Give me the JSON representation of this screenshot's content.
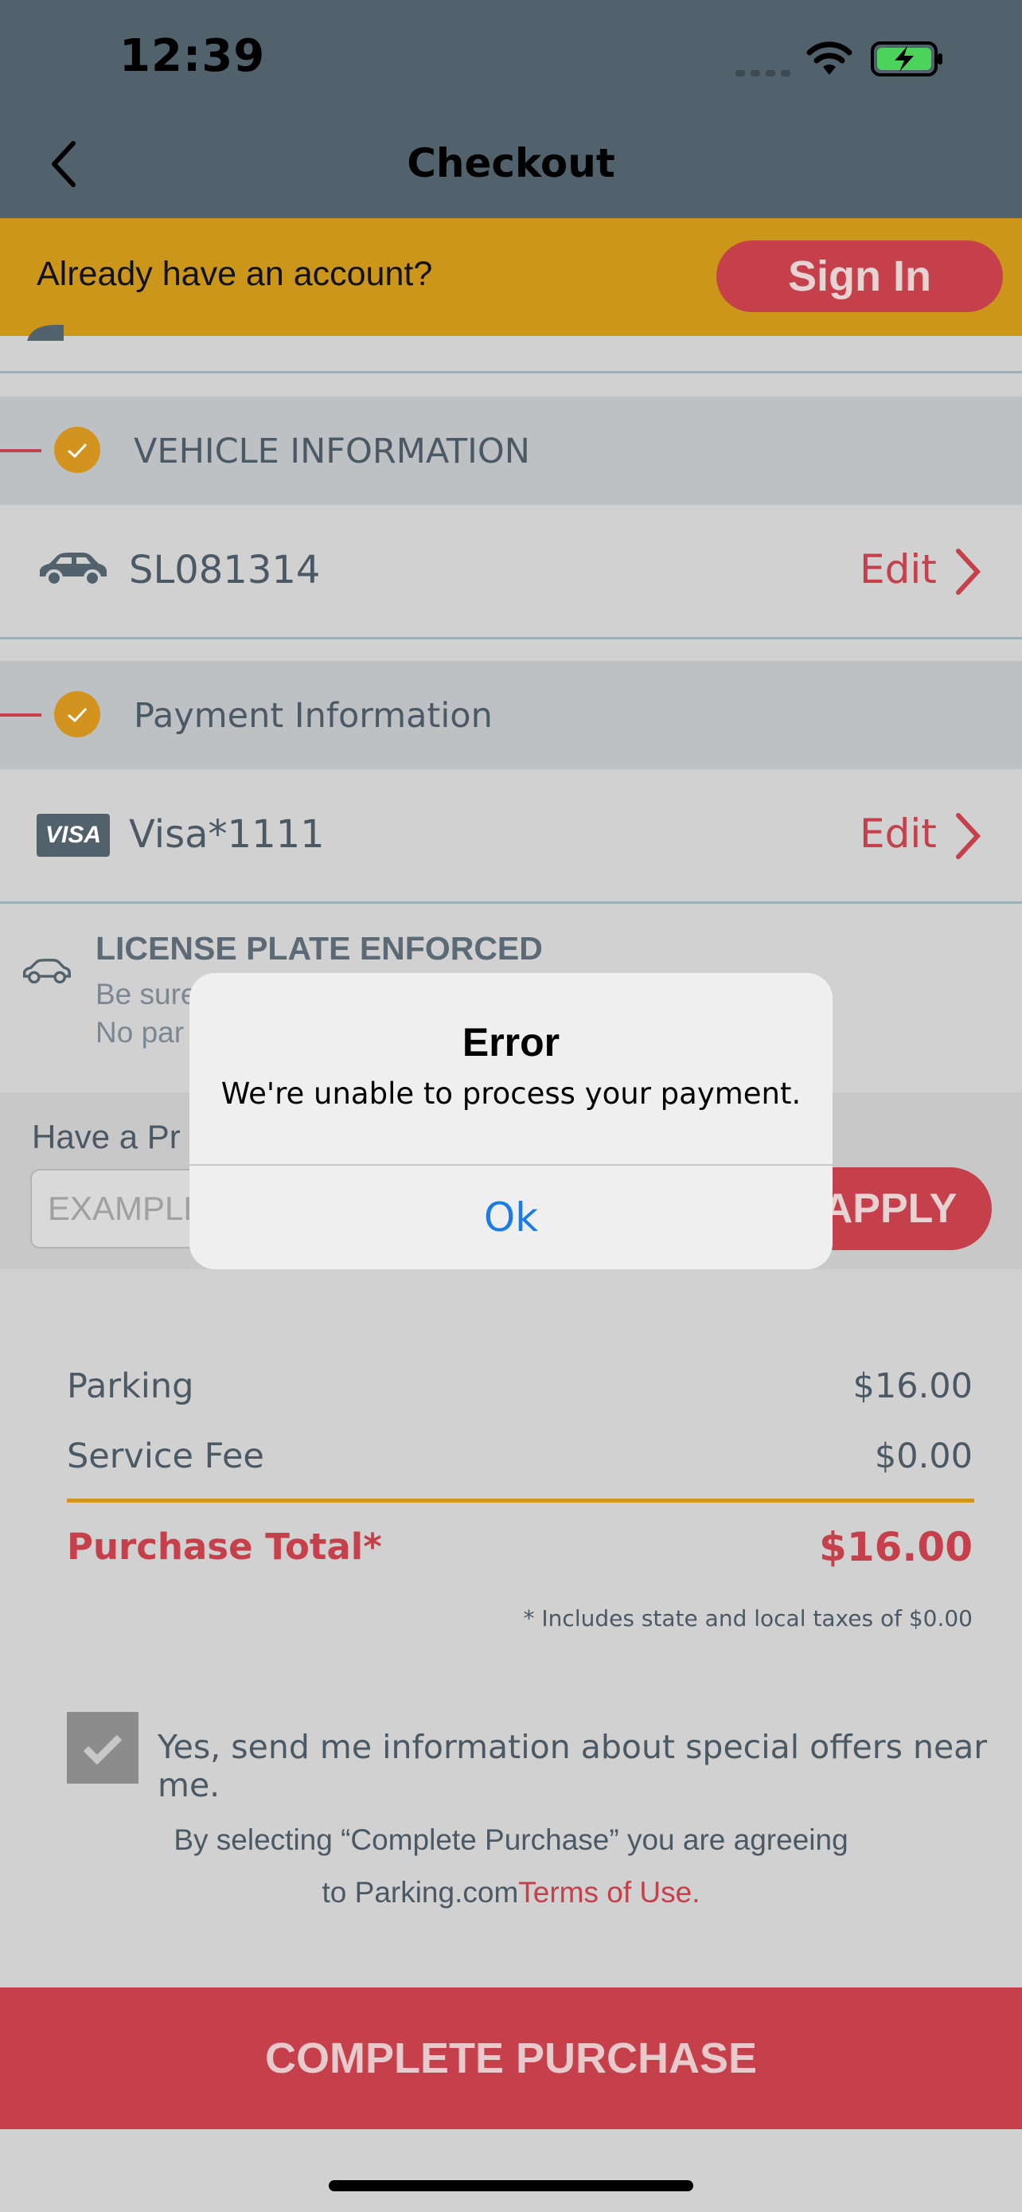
{
  "status_bar": {
    "time": "12:39"
  },
  "nav": {
    "title": "Checkout"
  },
  "banner": {
    "text": "Already have an account?",
    "sign_in_label": "Sign In"
  },
  "vehicle": {
    "header": "VEHICLE INFORMATION",
    "plate": "SL081314",
    "edit_label": "Edit"
  },
  "payment": {
    "header": "Payment Information",
    "card": "Visa*1111",
    "card_brand": "VISA",
    "edit_label": "Edit"
  },
  "enforcement": {
    "title": "LICENSE PLATE ENFORCED",
    "line1": "Be sure",
    "line2": "No par"
  },
  "promo": {
    "label": "Have a Pr",
    "placeholder": "EXAMPLE",
    "apply_label": "APPLY"
  },
  "summary": {
    "parking_label": "Parking",
    "parking_value": "$16.00",
    "fee_label": "Service Fee",
    "fee_value": "$0.00",
    "total_label": "Purchase Total*",
    "total_value": "$16.00",
    "tax_note": "* Includes state and local taxes of $0.00"
  },
  "optin": {
    "text": "Yes, send me information about special offers near me."
  },
  "terms": {
    "line1": "By selecting “Complete Purchase” you are agreeing",
    "line2_prefix": "to Parking.com",
    "link": "Terms of Use."
  },
  "complete_label": "COMPLETE PURCHASE",
  "alert": {
    "title": "Error",
    "message": "We're unable to process your payment.",
    "ok_label": "Ok"
  },
  "colors": {
    "accent": "#c5404a",
    "nav_bg": "#52626c",
    "banner_bg": "#cc961a",
    "check": "#d3931f",
    "ios_blue": "#1a7ce6"
  }
}
